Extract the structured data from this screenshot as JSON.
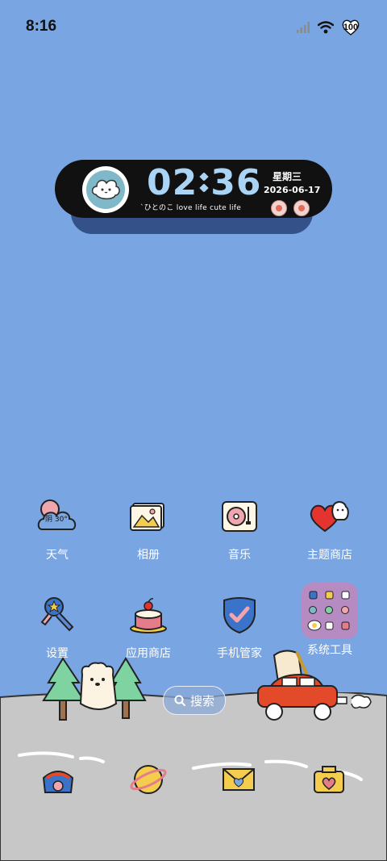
{
  "status": {
    "time": "8:16",
    "battery": "100",
    "icons": [
      "signal-icon",
      "wifi-icon",
      "battery-icon"
    ]
  },
  "clock_widget": {
    "time_hour": "02",
    "time_minute": "36",
    "weekday": "星期三",
    "date": "2026-06-17",
    "motto": "`ひとのこ love life cute life"
  },
  "apps_row1": [
    {
      "label": "天气",
      "icon": "weather-icon",
      "temp_text": "阴 30°"
    },
    {
      "label": "相册",
      "icon": "photo-album-icon"
    },
    {
      "label": "音乐",
      "icon": "music-player-icon"
    },
    {
      "label": "主题商店",
      "icon": "theme-store-icon"
    }
  ],
  "apps_row2": [
    {
      "label": "设置",
      "icon": "settings-icon"
    },
    {
      "label": "应用商店",
      "icon": "app-store-icon"
    },
    {
      "label": "手机管家",
      "icon": "phone-manager-icon"
    },
    {
      "label": "系统工具",
      "icon": "system-tools-folder-icon"
    }
  ],
  "search": {
    "label": "搜索"
  },
  "dock": [
    {
      "icon": "phone-icon"
    },
    {
      "icon": "browser-planet-icon"
    },
    {
      "icon": "messages-envelope-icon"
    },
    {
      "icon": "camera-icon"
    }
  ],
  "colors": {
    "sky": "#79a5e2",
    "ground": "#c7c7c7",
    "widget_bg": "#111111",
    "widget_digits": "#a9d4f5"
  }
}
